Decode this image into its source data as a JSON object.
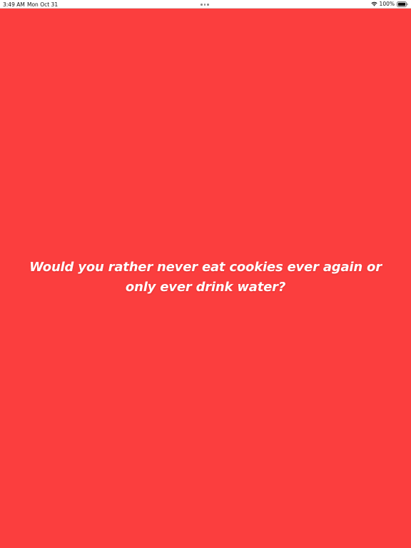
{
  "status_bar": {
    "time": "3:49 AM",
    "date": "Mon Oct 31",
    "battery": "100%"
  },
  "main": {
    "background_color": "#fb3e3e",
    "question": "Would you rather never eat cookies ever again or only ever drink water?"
  },
  "icons": {
    "wifi": "wifi-icon",
    "battery": "battery-icon",
    "multitasking": "multitasking-dots-icon"
  }
}
